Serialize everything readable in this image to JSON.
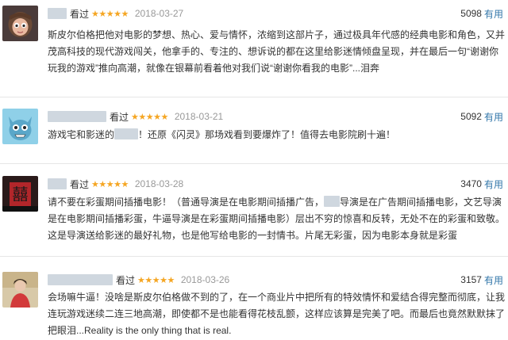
{
  "reviews": [
    {
      "action": "看过",
      "stars": "★★★★★",
      "date": "2018-03-27",
      "votes": "5098",
      "vote_label": "有用",
      "text": "斯皮尔伯格把他对电影的梦想、热心、爱与情怀，浓缩到这部片子，通过极具年代感的经典电影和角色，又并茂高科技的现代游戏闯关，他拿手的、专注的、想诉说的都在这里给影迷情倾盘呈现，并在最后一句“谢谢你玩我的游戏”推向高潮，就像在银幕前看着他对我们说“谢谢你看我的电影”...泪奔"
    },
    {
      "action": "看过",
      "stars": "★★★★★",
      "date": "2018-03-21",
      "votes": "5092",
      "vote_label": "有用",
      "text_before": "游戏宅和影迷的",
      "text_after": "！还原《闪灵》那场戏看到要爆炸了！值得去电影院刷十遍！"
    },
    {
      "action": "看过",
      "stars": "★★★★★",
      "date": "2018-03-28",
      "votes": "3470",
      "vote_label": "有用",
      "text_before": "请不要在彩蛋期间插播电影！（普通导演是在电影期间插播广告，",
      "text_after": "导演是在广告期间插播电影，文艺导演是在电影期间插播彩蛋，牛逼导演是在彩蛋期间插播电影）层出不穷的惊喜和反转，无处不在的彩蛋和致敬。这是导演送给影迷的最好礼物，也是他写给电影的一封情书。片尾无彩蛋，因为电影本身就是彩蛋"
    },
    {
      "action": "看过",
      "stars": "★★★★★",
      "date": "2018-03-26",
      "votes": "3157",
      "vote_label": "有用",
      "text": "会场嘛牛逼！没啥是斯皮尔伯格做不到的了，在一个商业片中把所有的特效情怀和爱结合得完整而彻底，让我连玩游戏迷续二连三地高潮，即使都不是也能看得花枝乱颤，这样应该算是完美了吧。而最后也竟然默默抹了把眼泪...Reality is the only thing that is real."
    }
  ],
  "colors": {
    "star": "#f5a623",
    "vote_link": "#3377aa",
    "date": "#999999"
  }
}
